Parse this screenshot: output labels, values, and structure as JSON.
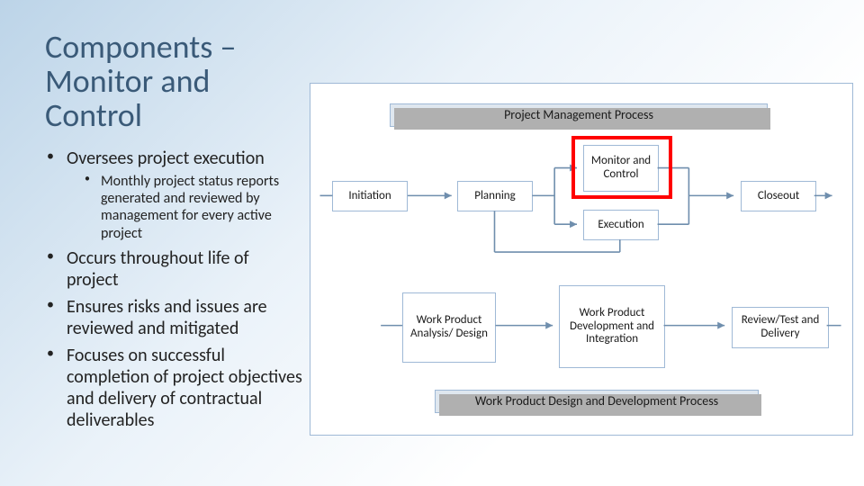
{
  "title": "Components – Monitor and Control",
  "bullets": [
    {
      "text": "Oversees project execution",
      "sub": [
        "Monthly project status reports generated and reviewed by management for every active project"
      ]
    },
    {
      "text": "Occurs throughout life of project"
    },
    {
      "text": "Ensures risks and issues are reviewed and mitigated"
    },
    {
      "text": "Focuses on successful completion of project objectives and delivery of contractual deliverables"
    }
  ],
  "diagram": {
    "header_top": "Project Management Process",
    "header_bottom": "Work Product Design and Development Process",
    "boxes": {
      "initiation": "Initiation",
      "planning": "Planning",
      "monitor": "Monitor and Control",
      "execution": "Execution",
      "closeout": "Closeout",
      "wp_analysis": "Work Product Analysis/ Design",
      "wp_dev": "Work Product Development and Integration",
      "wp_review": "Review/Test and Delivery"
    }
  }
}
